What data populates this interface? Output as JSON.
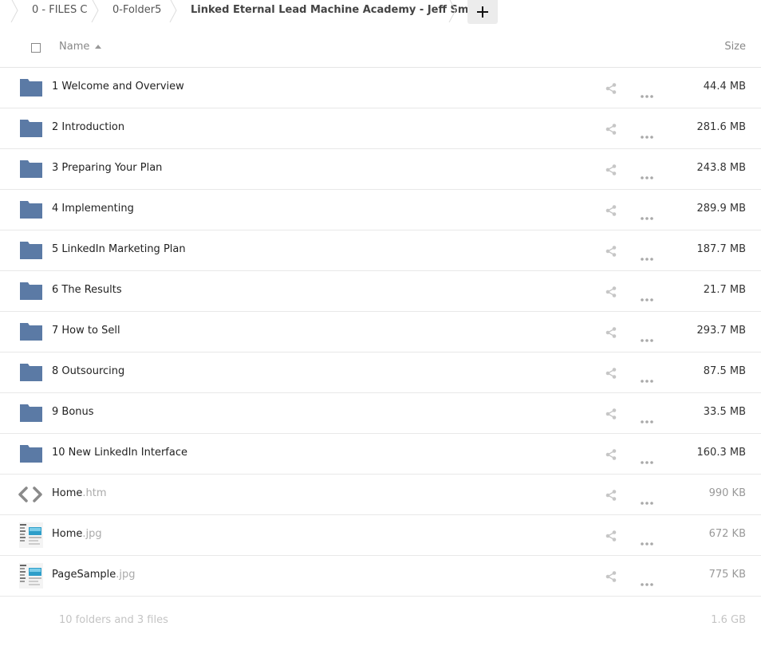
{
  "breadcrumb": {
    "items": [
      {
        "label": "0 - FILES C"
      },
      {
        "label": "0-Folder5"
      },
      {
        "label": "Linked Eternal Lead Machine Academy - Jeff Smith"
      }
    ],
    "add_label": "+"
  },
  "header": {
    "name_label": "Name",
    "size_label": "Size"
  },
  "rows": [
    {
      "name": "1 Welcome and Overview",
      "ext": "",
      "size": "44.4 MB",
      "icon": "folder-icon"
    },
    {
      "name": "2 Introduction",
      "ext": "",
      "size": "281.6 MB",
      "icon": "folder-icon"
    },
    {
      "name": "3 Preparing Your Plan",
      "ext": "",
      "size": "243.8 MB",
      "icon": "folder-icon"
    },
    {
      "name": "4 Implementing",
      "ext": "",
      "size": "289.9 MB",
      "icon": "folder-icon"
    },
    {
      "name": "5 LinkedIn Marketing Plan",
      "ext": "",
      "size": "187.7 MB",
      "icon": "folder-icon"
    },
    {
      "name": "6 The Results",
      "ext": "",
      "size": "21.7 MB",
      "icon": "folder-icon"
    },
    {
      "name": "7 How to Sell",
      "ext": "",
      "size": "293.7 MB",
      "icon": "folder-icon"
    },
    {
      "name": "8 Outsourcing",
      "ext": "",
      "size": "87.5 MB",
      "icon": "folder-icon"
    },
    {
      "name": "9 Bonus",
      "ext": "",
      "size": "33.5 MB",
      "icon": "folder-icon"
    },
    {
      "name": "10 New LinkedIn Interface",
      "ext": "",
      "size": "160.3 MB",
      "icon": "folder-icon"
    },
    {
      "name": "Home",
      "ext": ".htm",
      "size": "990 KB",
      "icon": "code-file-icon"
    },
    {
      "name": "Home",
      "ext": ".jpg",
      "size": "672 KB",
      "icon": "image-thumbnail-icon"
    },
    {
      "name": "PageSample",
      "ext": ".jpg",
      "size": "775 KB",
      "icon": "image-thumbnail-icon"
    }
  ],
  "summary": {
    "text": "10 folders and 3 files",
    "size": "1.6 GB"
  },
  "colors": {
    "folder": "#5b7aa5",
    "icon_gray": "#c6c6c6"
  }
}
